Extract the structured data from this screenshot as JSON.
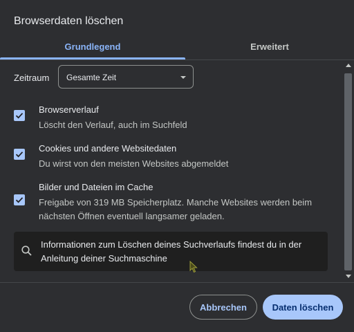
{
  "dialog": {
    "title": "Browserdaten löschen"
  },
  "tabs": [
    {
      "label": "Grundlegend",
      "selected": true
    },
    {
      "label": "Erweitert",
      "selected": false
    }
  ],
  "time_range": {
    "label": "Zeitraum",
    "value": "Gesamte Zeit"
  },
  "options": [
    {
      "title": "Browserverlauf",
      "description": "Löscht den Verlauf, auch im Suchfeld",
      "checked": true
    },
    {
      "title": "Cookies und andere Websitedaten",
      "description": "Du wirst von den meisten Websites abgemeldet",
      "checked": true
    },
    {
      "title": "Bilder und Dateien im Cache",
      "description": "Freigabe von 319 MB Speicherplatz. Manche Websites werden beim nächsten Öffnen eventuell langsamer geladen.",
      "checked": true
    }
  ],
  "info": {
    "icon": "search-icon",
    "text": "Informationen zum Löschen deines Suchverlaufs findest du in der Anleitung deiner Suchmaschine"
  },
  "buttons": {
    "cancel": "Abbrechen",
    "delete": "Daten löschen"
  },
  "colors": {
    "background": "#2d2e31",
    "accent": "#a8c7fa",
    "tab_active": "#8ab4f8",
    "info_box": "#1f1f1f"
  }
}
